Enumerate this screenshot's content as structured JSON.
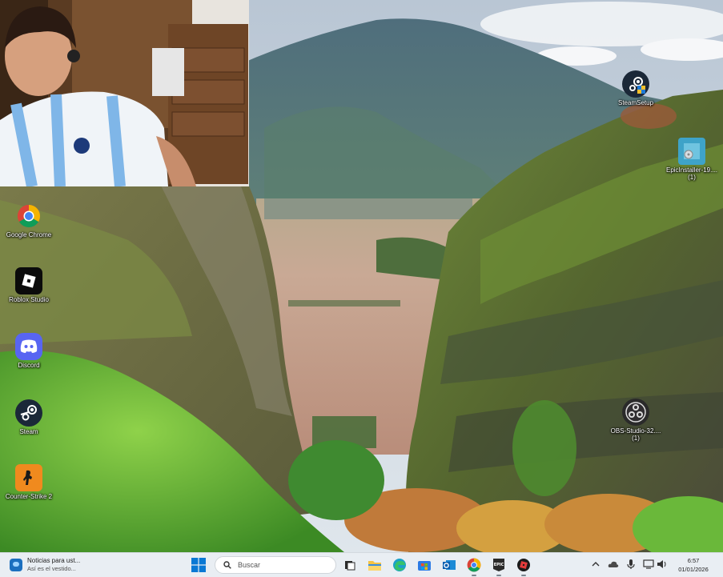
{
  "desktop_icons": [
    {
      "label": "Google Chrome",
      "icon": "chrome-icon"
    },
    {
      "label": "Roblox Studio",
      "icon": "roblox-studio-icon"
    },
    {
      "label": "Discord",
      "icon": "discord-icon"
    },
    {
      "label": "Steam",
      "icon": "steam-icon"
    },
    {
      "label": "Counter-Strike 2",
      "icon": "counter-strike-2-icon"
    },
    {
      "label": "SteamSetup",
      "icon": "steam-setup-icon"
    },
    {
      "label": "EpicInstaller-19....(1)",
      "icon": "epic-installer-icon"
    },
    {
      "label": "OBS-Studio-32....(1)",
      "icon": "obs-studio-icon"
    }
  ],
  "taskbar": {
    "news_title": "Noticias para ust...",
    "news_subtitle": "Así es el vestido...",
    "search_placeholder": "Buscar",
    "apps": [
      "task-view-icon",
      "file-explorer-icon",
      "edge-icon",
      "store-icon",
      "outlook-icon",
      "chrome-icon",
      "epic-games-icon",
      "roblox-icon"
    ],
    "tray": [
      "chevron-up-icon",
      "onedrive-icon",
      "microphone-icon",
      "network-icon",
      "volume-icon",
      "battery-icon"
    ],
    "time": "6:57",
    "date": "01/01/2026"
  },
  "colors": {
    "taskbar_bg": "#e9eef3",
    "accent": "#0078d4"
  }
}
